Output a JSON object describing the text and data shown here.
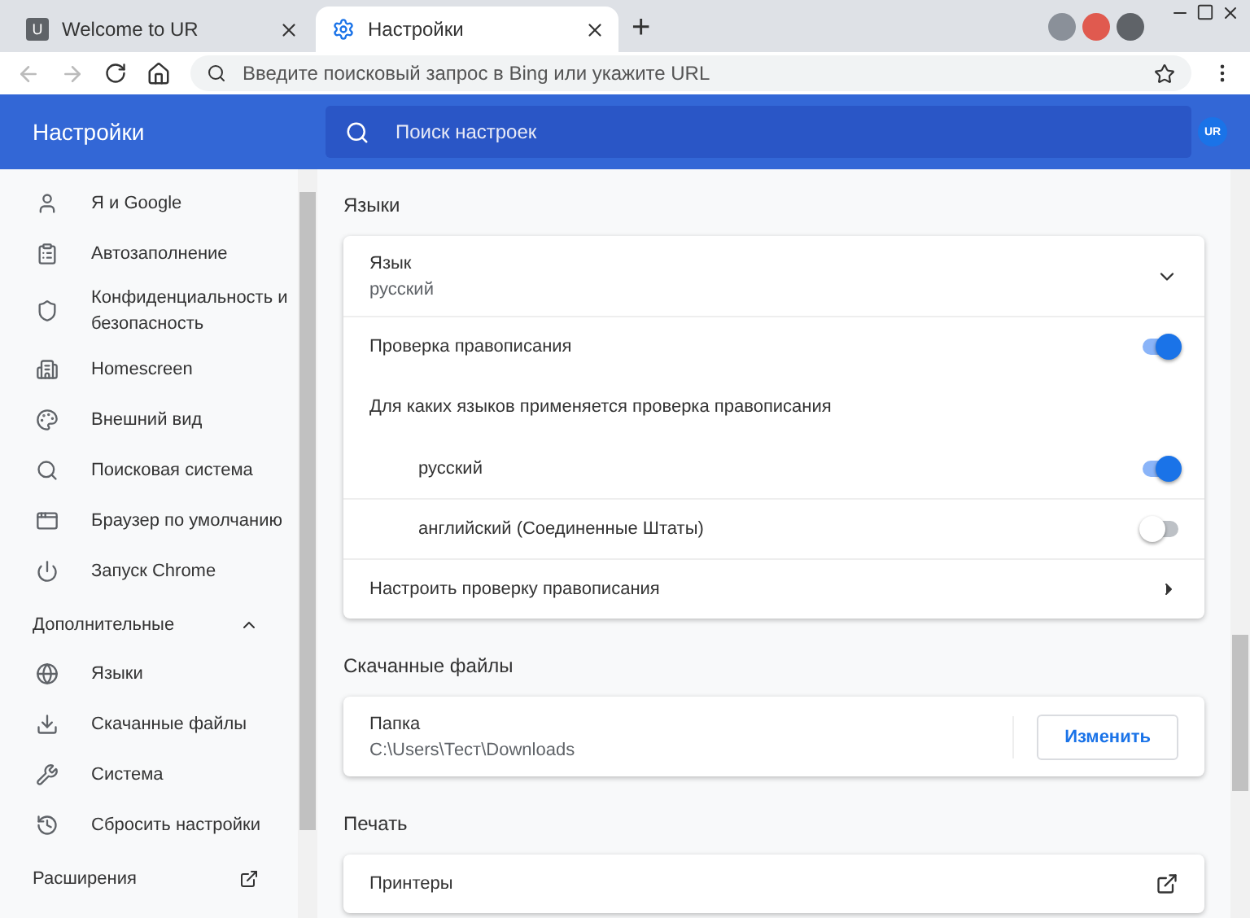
{
  "tabs": [
    {
      "label": "Welcome to UR",
      "selected": false,
      "kind": "page",
      "favicon": "U"
    },
    {
      "label": "Настройки",
      "selected": true,
      "kind": "settings"
    }
  ],
  "new_tab": "+",
  "address_bar": {
    "placeholder": "Введите поисковый запрос в Bing или укажите URL"
  },
  "header": {
    "title": "Настройки",
    "search": {
      "placeholder": "Поиск настроек"
    },
    "avatar": "UR"
  },
  "sidebar": {
    "items": [
      {
        "label": "Я и Google",
        "selected": false
      },
      {
        "label": "Автозаполнение",
        "selected": false
      },
      {
        "label": "Конфиденциальность и безопасность",
        "selected": false
      },
      {
        "label": "Homescreen",
        "selected": false
      },
      {
        "label": "Внешний вид",
        "selected": false
      },
      {
        "label": "Поисковая система",
        "selected": false
      },
      {
        "label": "Браузер по умолчанию",
        "selected": false
      },
      {
        "label": "Запуск Chrome",
        "selected": false
      }
    ],
    "advanced": {
      "label": "Дополнительные",
      "expanded": true,
      "items": [
        {
          "label": "Языки",
          "selected": false
        },
        {
          "label": "Скачанные файлы",
          "selected": false
        },
        {
          "label": "Система",
          "selected": false
        },
        {
          "label": "Сбросить настройки",
          "selected": false
        }
      ]
    },
    "extensions": {
      "label": "Расширения"
    }
  },
  "sections": [
    {
      "title": "Языки",
      "rows": [
        {
          "kind": "dropdown",
          "label": "Язык",
          "value": "русский",
          "expanded": false
        },
        {
          "kind": "toggle",
          "label": "Проверка правописания",
          "on": true
        },
        {
          "kind": "note",
          "label": "Для каких языков применяется проверка правописания"
        },
        {
          "kind": "language",
          "label": "русский",
          "on": true
        },
        {
          "kind": "language",
          "label": "английский (Соединенные Штаты)",
          "on": false
        },
        {
          "kind": "link",
          "label": "Настроить проверку правописания"
        }
      ]
    },
    {
      "title": "Скачанные файлы",
      "rows": [
        {
          "kind": "folder",
          "label": "Папка",
          "value": "C:\\Users\\Тест\\Downloads",
          "button": "Изменить"
        }
      ]
    },
    {
      "title": "Печать",
      "rows": [
        {
          "kind": "external",
          "label": "Принтеры"
        }
      ]
    }
  ]
}
